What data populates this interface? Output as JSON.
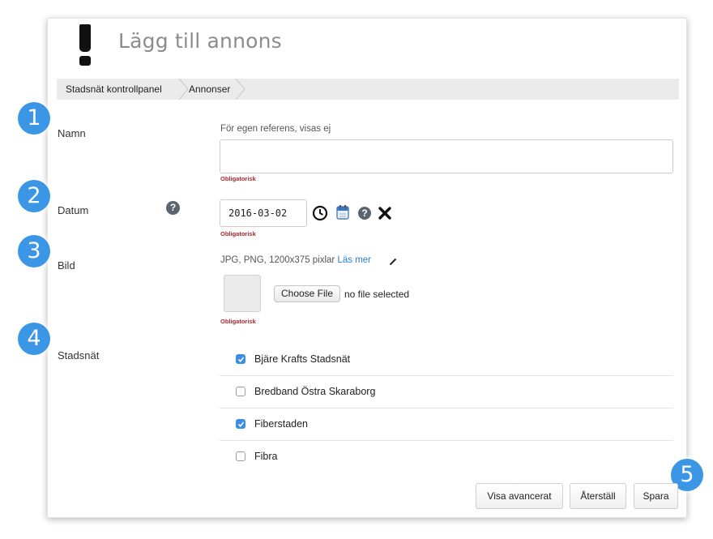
{
  "header": {
    "title": "Lägg till annons",
    "icon": "exclamation-icon"
  },
  "breadcrumb": [
    "Stadsnät kontrollpanel",
    "Annonser"
  ],
  "steps": [
    "1",
    "2",
    "3",
    "4",
    "5"
  ],
  "form": {
    "namn": {
      "label": "Namn",
      "hint": "För egen referens, visas ej",
      "value": "",
      "required": "Obligatorisk"
    },
    "datum": {
      "label": "Datum",
      "help": "?",
      "value": "2016-03-02",
      "required": "Obligatorisk",
      "icons": [
        "clock-icon",
        "calendar-icon",
        "help-icon",
        "clear-icon"
      ]
    },
    "bild": {
      "label": "Bild",
      "hint": "JPG, PNG, 1200x375 pixlar",
      "hint_link": "Läs mer",
      "choose_button": "Choose File",
      "file_status": "no file selected",
      "required": "Obligatorisk"
    },
    "stadsnat": {
      "label": "Stadsnät",
      "options": [
        {
          "label": "Bjäre Krafts Stadsnät",
          "checked": true
        },
        {
          "label": "Bredband Östra Skaraborg",
          "checked": false
        },
        {
          "label": "Fiberstaden",
          "checked": true
        },
        {
          "label": "Fibra",
          "checked": false
        }
      ]
    }
  },
  "buttons": {
    "advanced": "Visa avancerat",
    "reset": "Återställ",
    "save": "Spara"
  },
  "colors": {
    "badge": "#3b96e6",
    "required": "#b0262c",
    "link": "#2a7fd4",
    "checkbox_checked": "#3a8ee6"
  }
}
